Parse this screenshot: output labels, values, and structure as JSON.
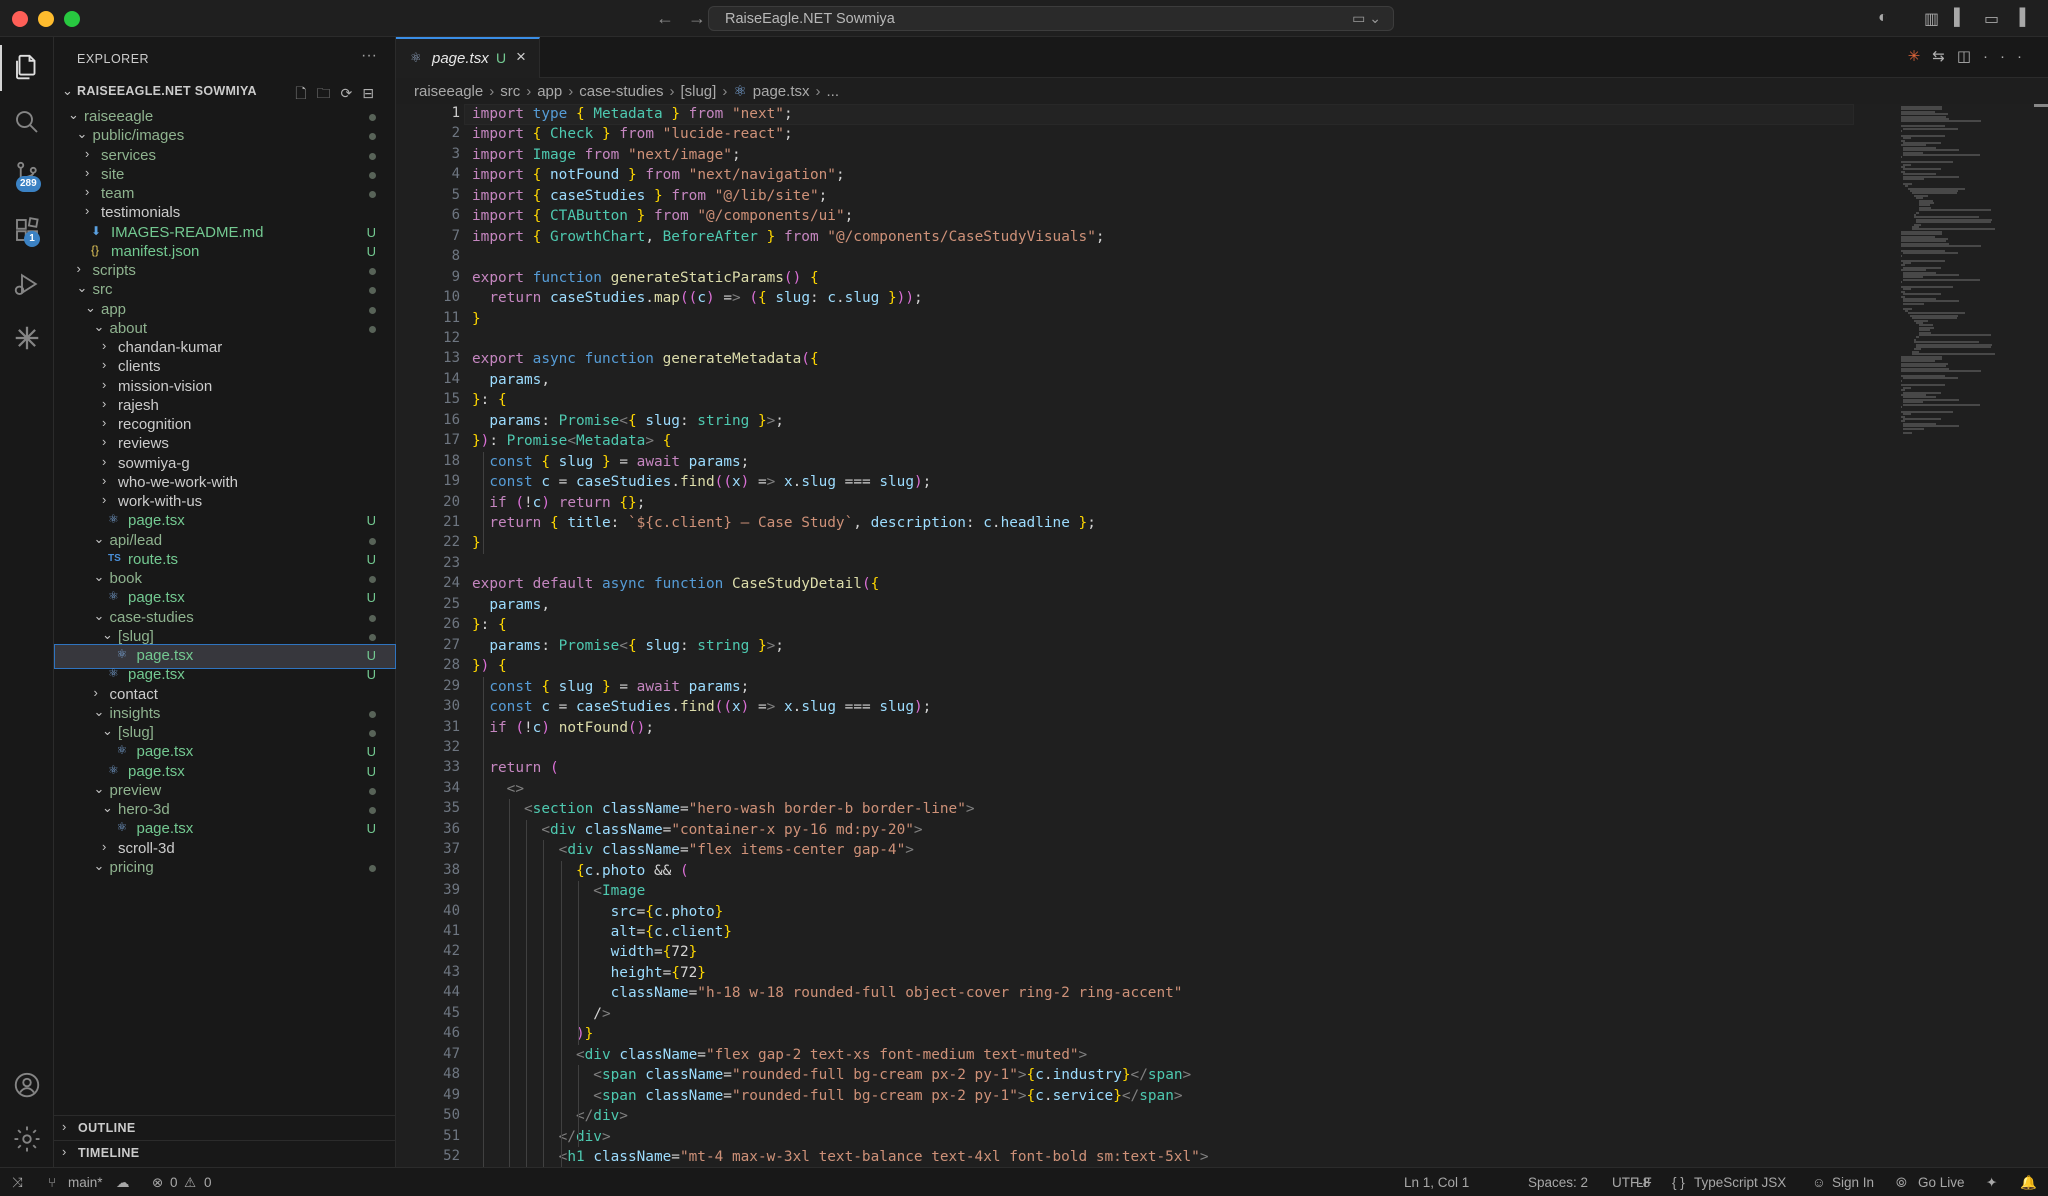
{
  "window": {
    "title": "RaiseEagle.NET Sowmiya"
  },
  "activity_bar": {
    "source_control_badge": "289",
    "extensions_badge": "1"
  },
  "explorer": {
    "title": "EXPLORER",
    "root": "RAISEEAGLE.NET SOWMIYA",
    "tree": [
      {
        "name": "raiseeagle",
        "depth": 0,
        "kind": "folder-open",
        "status": "dot"
      },
      {
        "name": "public/images",
        "depth": 1,
        "kind": "folder-open",
        "status": "dot"
      },
      {
        "name": "services",
        "depth": 2,
        "kind": "folder",
        "status": "dot"
      },
      {
        "name": "site",
        "depth": 2,
        "kind": "folder",
        "status": "dot"
      },
      {
        "name": "team",
        "depth": 2,
        "kind": "folder",
        "status": "dot"
      },
      {
        "name": "testimonials",
        "depth": 2,
        "kind": "folder",
        "status": ""
      },
      {
        "name": "IMAGES-README.md",
        "depth": 2,
        "kind": "md",
        "status": "U"
      },
      {
        "name": "manifest.json",
        "depth": 2,
        "kind": "json",
        "status": "U"
      },
      {
        "name": "scripts",
        "depth": 1,
        "kind": "folder",
        "status": "dot"
      },
      {
        "name": "src",
        "depth": 1,
        "kind": "folder-open",
        "status": "dot"
      },
      {
        "name": "app",
        "depth": 2,
        "kind": "folder-open",
        "status": "dot"
      },
      {
        "name": "about",
        "depth": 3,
        "kind": "folder-open",
        "status": "dot"
      },
      {
        "name": "chandan-kumar",
        "depth": 4,
        "kind": "folder",
        "status": ""
      },
      {
        "name": "clients",
        "depth": 4,
        "kind": "folder",
        "status": ""
      },
      {
        "name": "mission-vision",
        "depth": 4,
        "kind": "folder",
        "status": ""
      },
      {
        "name": "rajesh",
        "depth": 4,
        "kind": "folder",
        "status": ""
      },
      {
        "name": "recognition",
        "depth": 4,
        "kind": "folder",
        "status": ""
      },
      {
        "name": "reviews",
        "depth": 4,
        "kind": "folder",
        "status": ""
      },
      {
        "name": "sowmiya-g",
        "depth": 4,
        "kind": "folder",
        "status": ""
      },
      {
        "name": "who-we-work-with",
        "depth": 4,
        "kind": "folder",
        "status": ""
      },
      {
        "name": "work-with-us",
        "depth": 4,
        "kind": "folder",
        "status": ""
      },
      {
        "name": "page.tsx",
        "depth": 4,
        "kind": "tsx",
        "status": "U"
      },
      {
        "name": "api/lead",
        "depth": 3,
        "kind": "folder-open",
        "status": "dot"
      },
      {
        "name": "route.ts",
        "depth": 4,
        "kind": "ts",
        "status": "U"
      },
      {
        "name": "book",
        "depth": 3,
        "kind": "folder-open",
        "status": "dot"
      },
      {
        "name": "page.tsx",
        "depth": 4,
        "kind": "tsx",
        "status": "U"
      },
      {
        "name": "case-studies",
        "depth": 3,
        "kind": "folder-open",
        "status": "dot"
      },
      {
        "name": "[slug]",
        "depth": 4,
        "kind": "folder-open",
        "status": "dot"
      },
      {
        "name": "page.tsx",
        "depth": 5,
        "kind": "tsx",
        "status": "U",
        "selected": true
      },
      {
        "name": "page.tsx",
        "depth": 4,
        "kind": "tsx",
        "status": "U"
      },
      {
        "name": "contact",
        "depth": 3,
        "kind": "folder",
        "status": ""
      },
      {
        "name": "insights",
        "depth": 3,
        "kind": "folder-open",
        "status": "dot"
      },
      {
        "name": "[slug]",
        "depth": 4,
        "kind": "folder-open",
        "status": "dot"
      },
      {
        "name": "page.tsx",
        "depth": 5,
        "kind": "tsx",
        "status": "U"
      },
      {
        "name": "page.tsx",
        "depth": 4,
        "kind": "tsx",
        "status": "U"
      },
      {
        "name": "preview",
        "depth": 3,
        "kind": "folder-open",
        "status": "dot"
      },
      {
        "name": "hero-3d",
        "depth": 4,
        "kind": "folder-open",
        "status": "dot"
      },
      {
        "name": "page.tsx",
        "depth": 5,
        "kind": "tsx",
        "status": "U"
      },
      {
        "name": "scroll-3d",
        "depth": 4,
        "kind": "folder",
        "status": ""
      },
      {
        "name": "pricing",
        "depth": 3,
        "kind": "folder-open",
        "status": "dot"
      }
    ],
    "outline_label": "OUTLINE",
    "timeline_label": "TIMELINE"
  },
  "editor": {
    "tab": {
      "name": "page.tsx",
      "status": "U"
    },
    "breadcrumb": [
      "raiseeagle",
      "src",
      "app",
      "case-studies",
      "[slug]",
      "page.tsx",
      "..."
    ],
    "current_line": 1,
    "lines": [
      "import type { Metadata } from \"next\";",
      "import { Check } from \"lucide-react\";",
      "import Image from \"next/image\";",
      "import { notFound } from \"next/navigation\";",
      "import { caseStudies } from \"@/lib/site\";",
      "import { CTAButton } from \"@/components/ui\";",
      "import { GrowthChart, BeforeAfter } from \"@/components/CaseStudyVisuals\";",
      "",
      "export function generateStaticParams() {",
      "  return caseStudies.map((c) => ({ slug: c.slug }));",
      "}",
      "",
      "export async function generateMetadata({",
      "  params,",
      "}: {",
      "  params: Promise<{ slug: string }>;",
      "}): Promise<Metadata> {",
      "  const { slug } = await params;",
      "  const c = caseStudies.find((x) => x.slug === slug);",
      "  if (!c) return {};",
      "  return { title: `${c.client} – Case Study`, description: c.headline };",
      "}",
      "",
      "export default async function CaseStudyDetail({",
      "  params,",
      "}: {",
      "  params: Promise<{ slug: string }>;",
      "}) {",
      "  const { slug } = await params;",
      "  const c = caseStudies.find((x) => x.slug === slug);",
      "  if (!c) notFound();",
      "",
      "  return (",
      "    <>",
      "      <section className=\"hero-wash border-b border-line\">",
      "        <div className=\"container-x py-16 md:py-20\">",
      "          <div className=\"flex items-center gap-4\">",
      "            {c.photo && (",
      "              <Image",
      "                src={c.photo}",
      "                alt={c.client}",
      "                width={72}",
      "                height={72}",
      "                className=\"h-18 w-18 rounded-full object-cover ring-2 ring-accent\"",
      "              />",
      "            )}",
      "            <div className=\"flex gap-2 text-xs font-medium text-muted\">",
      "              <span className=\"rounded-full bg-cream px-2 py-1\">{c.industry}</span>",
      "              <span className=\"rounded-full bg-cream px-2 py-1\">{c.service}</span>",
      "            </div>",
      "          </div>",
      "          <h1 className=\"mt-4 max-w-3xl text-balance text-4xl font-bold sm:text-5xl\">"
    ]
  },
  "status_bar": {
    "branch": "main*",
    "errors": "0",
    "warnings": "0",
    "cursor": "Ln 1, Col 1",
    "spaces": "Spaces: 2",
    "encoding": "UTF-8",
    "eol": "LF",
    "language": "TypeScript JSX",
    "sign_in": "Sign In",
    "go_live": "Go Live"
  },
  "colors": {
    "accent_blue": "#3a8ee6",
    "untracked_green": "#73c991",
    "editor_bg": "#1f1f1f",
    "sidebar_bg": "#181818"
  },
  "icons": [
    "files-icon",
    "search-icon",
    "source-control-icon",
    "extensions-icon",
    "run-debug-icon",
    "claude-icon",
    "account-icon",
    "settings-gear-icon"
  ]
}
